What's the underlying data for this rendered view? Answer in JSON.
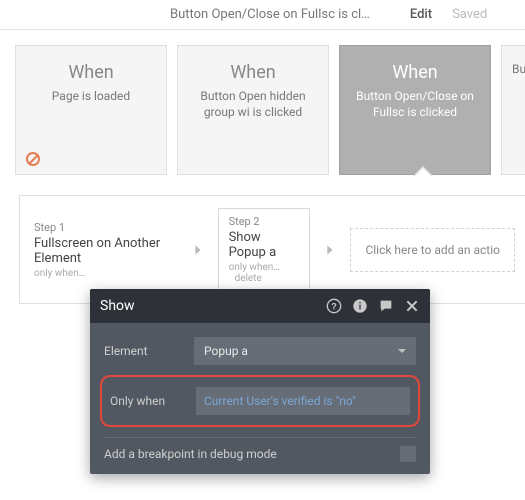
{
  "topbar": {
    "page_title": "Button Open/Close on Fullsc is cl…",
    "edit_label": "Edit",
    "saved_label": "Saved"
  },
  "events": [
    {
      "when": "When",
      "desc": "Page is loaded",
      "selected": false,
      "no_icon": true
    },
    {
      "when": "When",
      "desc": "Button Open hidden group wi is clicked",
      "selected": false,
      "no_icon": false
    },
    {
      "when": "When",
      "desc": "Button Open/Close on Fullsc is clicked",
      "selected": true,
      "no_icon": false
    }
  ],
  "partial_event_desc": "Bu",
  "steps": {
    "step1_label": "Step 1",
    "step1_title": "Fullscreen on Another Element",
    "step1_meta": "only when…",
    "step2_label": "Step 2",
    "step2_title": "Show Popup a",
    "step2_meta": "only when…",
    "step2_delete": "delete",
    "add_label": "Click here to add an actio"
  },
  "panel": {
    "title": "Show",
    "element_label": "Element",
    "element_value": "Popup a",
    "only_when_label": "Only when",
    "only_when_expr": "Current User's verified is \"no\"",
    "breakpoint_label": "Add a breakpoint in debug mode"
  }
}
